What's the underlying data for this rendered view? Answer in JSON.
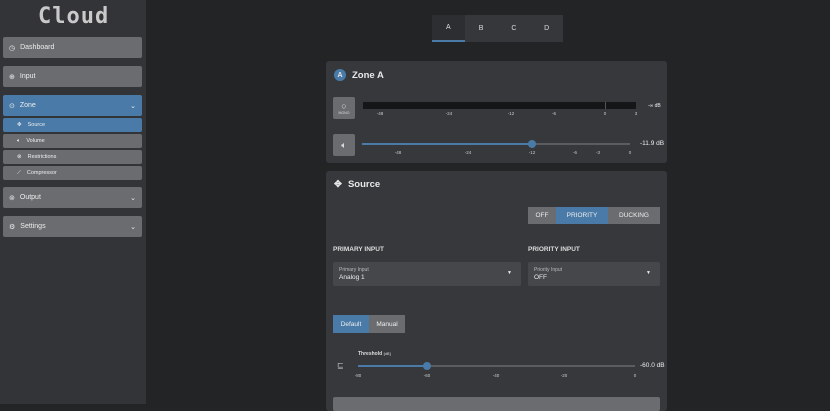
{
  "brand": "Cloud",
  "sidebar": {
    "items": [
      {
        "label": "Dashboard",
        "icon": "dashboard-icon"
      },
      {
        "label": "Input",
        "icon": "input-icon"
      },
      {
        "label": "Zone",
        "icon": "zone-icon"
      },
      {
        "label": "Output",
        "icon": "output-icon"
      },
      {
        "label": "Settings",
        "icon": "settings-icon"
      }
    ],
    "zone_sub": [
      {
        "label": "Source"
      },
      {
        "label": "Volume"
      },
      {
        "label": "Restrictions"
      },
      {
        "label": "Compressor"
      }
    ]
  },
  "tabs": [
    "A",
    "B",
    "C",
    "D"
  ],
  "zone": {
    "badge": "A",
    "title": "Zone A",
    "mono_label": "MONO",
    "meter_ticks": [
      "-48",
      "-24",
      "-12",
      "-6",
      "0",
      "3"
    ],
    "meter_value": "-∞ dB",
    "volume_ticks": [
      "-48",
      "-24",
      "-12",
      "-6",
      "-3",
      "0"
    ],
    "volume_value": "-11.9 dB",
    "volume_db": -11.9
  },
  "source": {
    "title": "Source",
    "modes": [
      "OFF",
      "PRIORITY",
      "DUCKING"
    ],
    "active_mode": "PRIORITY",
    "primary_heading": "PRIMARY INPUT",
    "priority_heading": "PRIORITY INPUT",
    "primary_select": {
      "label": "Primary Input",
      "value": "Analog 1"
    },
    "priority_select": {
      "label": "Priority Input",
      "value": "OFF"
    },
    "threshold_modes": [
      "Default",
      "Manual"
    ],
    "threshold_label": "Threshold",
    "threshold_unit": "[dB]",
    "threshold_ticks": [
      "-80",
      "-60",
      "-40",
      "-20",
      "0"
    ],
    "threshold_value": "-60.0 dB",
    "threshold_db": -60
  },
  "colors": {
    "accent": "#4a7ba8"
  }
}
